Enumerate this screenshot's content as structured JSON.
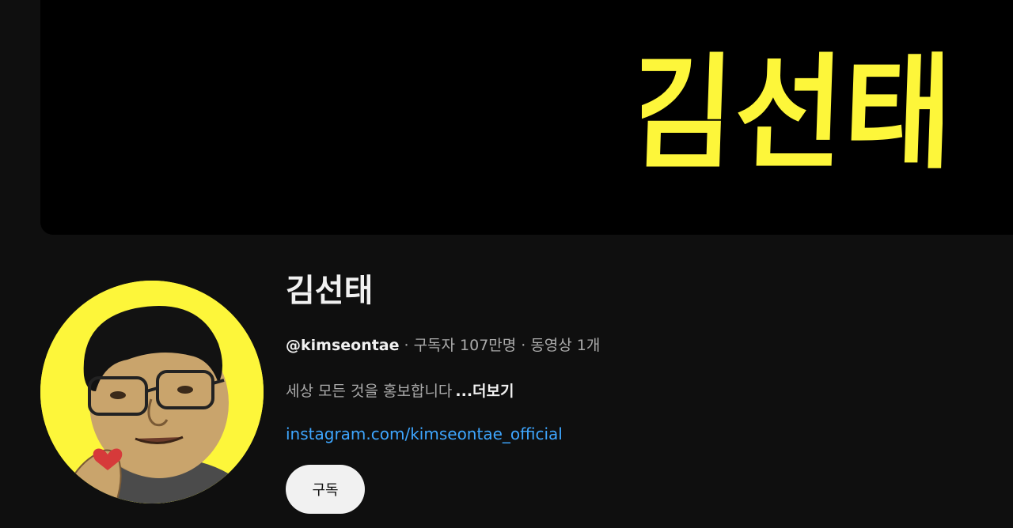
{
  "banner": {
    "logo_text": "김선태",
    "logo_color": "#fdf63a",
    "background": "#000000"
  },
  "avatar": {
    "background": "#fdf63a",
    "alt": "channel-avatar-illustration"
  },
  "channel": {
    "name": "김선태",
    "handle": "@kimseontae",
    "subscribers": "구독자 107만명",
    "videos": "동영상 1개",
    "separator": "·",
    "description": "세상 모든 것을 홍보합니다",
    "more_label": "...더보기",
    "link": "instagram.com/kimseontae_official",
    "subscribe_label": "구독"
  },
  "colors": {
    "page_bg": "#0f0f0f",
    "text_primary": "#f1f1f1",
    "text_secondary": "#aaaaaa",
    "link": "#3ea6ff",
    "button_bg": "#f1f1f1"
  }
}
